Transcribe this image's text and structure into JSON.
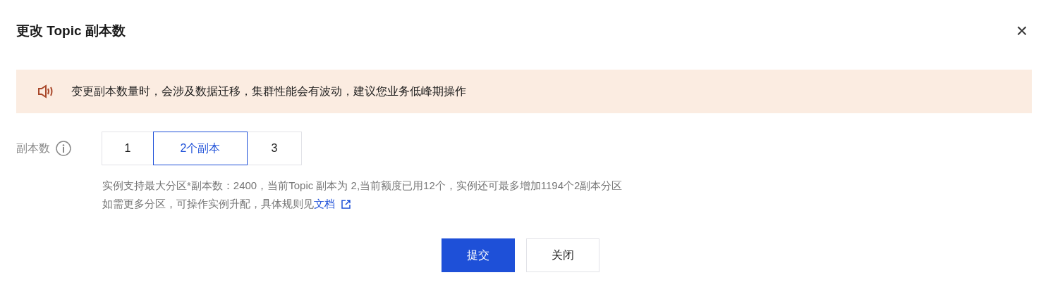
{
  "dialog": {
    "title": "更改 Topic 副本数",
    "close": "×"
  },
  "notice": {
    "text": "变更副本数量时，会涉及数据迁移，集群性能会有波动，建议您业务低峰期操作"
  },
  "replicas": {
    "label": "副本数",
    "options": [
      {
        "label": "1",
        "selected": false
      },
      {
        "label": "2个副本",
        "selected": true
      },
      {
        "label": "3",
        "selected": false
      }
    ],
    "help": [
      {
        "text": "实例支持最大分区*副本数：2400，当前Topic 副本为 2,当前额度已用12个，实例还可最多增加1194个2副本分区"
      },
      {
        "text": "如需更多分区，可操作实例升配，具体规则见",
        "link": "文档"
      }
    ]
  },
  "buttons": [
    {
      "label": "提交",
      "kind": "primary"
    },
    {
      "label": "关闭",
      "kind": "secondary"
    }
  ]
}
